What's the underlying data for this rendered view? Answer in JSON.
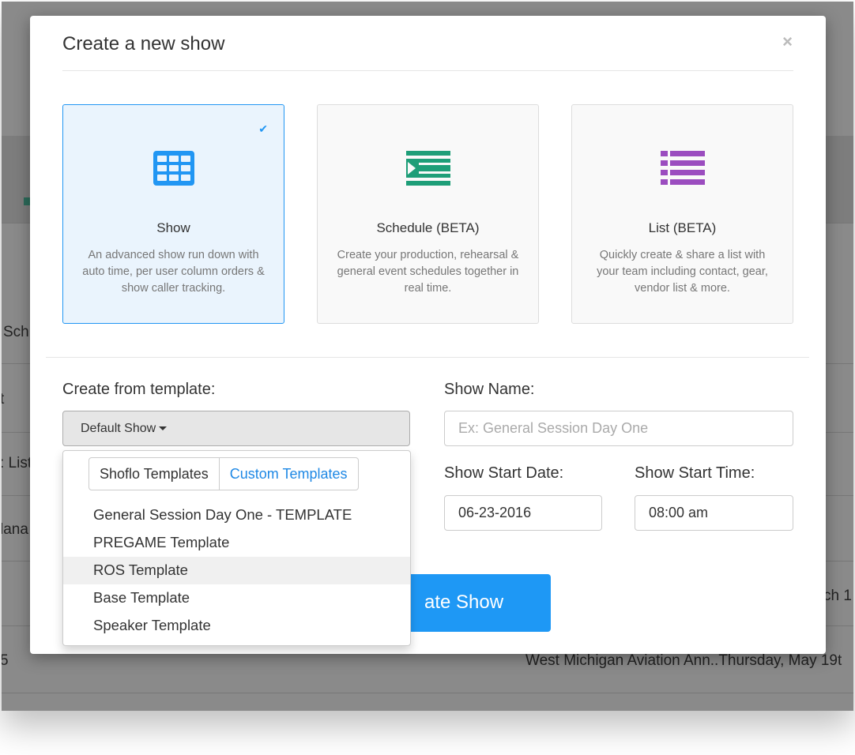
{
  "background": {
    "row_texts": [
      {
        "text": "Sch"
      },
      {
        "text": "t"
      },
      {
        "text": ": List"
      },
      {
        "text": "lana"
      },
      {
        "text": "ch 1"
      },
      {
        "text": "5"
      },
      {
        "text": "West Michigan Aviation Ann..Thursday, May 19t"
      }
    ]
  },
  "modal": {
    "title": "Create a new show",
    "close_label": "×",
    "cards": [
      {
        "icon": "grid-icon",
        "title": "Show",
        "description": "An advanced show run down with auto time, per user column orders & show caller tracking.",
        "selected": true,
        "color": "#2196f3"
      },
      {
        "icon": "schedule-icon",
        "title": "Schedule (BETA)",
        "description": "Create your production, rehearsal & general event schedules together in real time.",
        "selected": false,
        "color": "#1e9e78"
      },
      {
        "icon": "list-icon",
        "title": "List (BETA)",
        "description": "Quickly create & share a list with your team including contact, gear, vendor list & more.",
        "selected": false,
        "color": "#9b4dbf"
      }
    ],
    "check_mark": "✔",
    "template": {
      "label": "Create from template:",
      "selected": "Default Show",
      "tabs": [
        "Shoflo Templates",
        "Custom Templates"
      ],
      "items": [
        "General Session Day One - TEMPLATE",
        "PREGAME Template",
        "ROS Template",
        "Base Template",
        "Speaker Template"
      ],
      "hovered_index": 2
    },
    "show_name": {
      "label": "Show Name:",
      "placeholder": "Ex: General Session Day One"
    },
    "start_date": {
      "label": "Show Start Date:",
      "value": "06-23-2016"
    },
    "start_time": {
      "label": "Show Start Time:",
      "value": "08:00 am"
    },
    "create_button_label": "Create Show",
    "create_button_visible_text": "ate Show",
    "accent_color": "#1e98f5"
  }
}
